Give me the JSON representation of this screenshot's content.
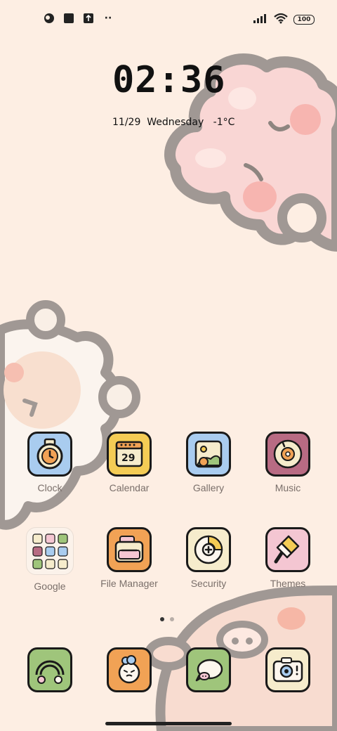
{
  "status_bar": {
    "left_icons": [
      "theme-app-icon",
      "notification-square-icon",
      "upload-icon",
      "more-dots-icon"
    ],
    "dots": "··",
    "right_icons": [
      "signal-icon",
      "wifi-icon"
    ],
    "battery": "100"
  },
  "clock_widget": {
    "time": "02:36",
    "date": "11/29  Wednesday   -1°C"
  },
  "apps_row1": [
    {
      "label": "Clock",
      "icon": "stopwatch-icon",
      "bg": "#a9ccef"
    },
    {
      "label": "Calendar",
      "icon": "calendar-icon",
      "bg": "#f4cc55",
      "day": "29"
    },
    {
      "label": "Gallery",
      "icon": "photo-icon",
      "bg": "#a9ccef"
    },
    {
      "label": "Music",
      "icon": "vinyl-icon",
      "bg": "#b86b83"
    }
  ],
  "apps_row2": [
    {
      "label": "Google",
      "icon": "folder-icon"
    },
    {
      "label": "File Manager",
      "icon": "wallet-icon",
      "bg": "#f1a255"
    },
    {
      "label": "Security",
      "icon": "shield-plus-icon",
      "bg": "#f6eccc"
    },
    {
      "label": "Themes",
      "icon": "paint-brush-icon",
      "bg": "#f4c6d2"
    }
  ],
  "dock": [
    {
      "icon": "phone-rainbow-icon",
      "bg": "#9fc57b"
    },
    {
      "icon": "sheep-face-icon",
      "bg": "#f1a255"
    },
    {
      "icon": "message-bubble-icon",
      "bg": "#9fc57b"
    },
    {
      "icon": "camera-icon",
      "bg": "#f6eccc"
    }
  ],
  "page_indicator": {
    "pages": 2,
    "current": 1
  },
  "colors": {
    "wallpaper": "#fdeee3",
    "outline": "#9d9490",
    "text_dark": "#111111",
    "label": "#7a6f6a"
  }
}
